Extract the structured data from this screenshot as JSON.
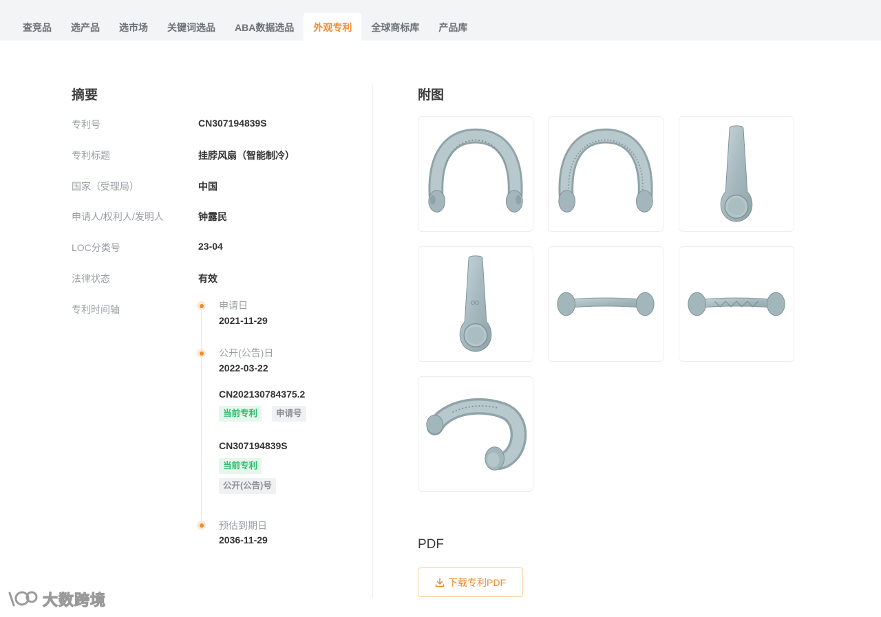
{
  "tabs": [
    {
      "label": "查竞品",
      "active": false
    },
    {
      "label": "选产品",
      "active": false
    },
    {
      "label": "选市场",
      "active": false
    },
    {
      "label": "关键词选品",
      "active": false
    },
    {
      "label": "ABA数据选品",
      "active": false
    },
    {
      "label": "外观专利",
      "active": true
    },
    {
      "label": "全球商标库",
      "active": false
    },
    {
      "label": "产品库",
      "active": false
    }
  ],
  "summary": {
    "title": "摘要",
    "fields": [
      {
        "label": "专利号",
        "value": "CN307194839S"
      },
      {
        "label": "专利标题",
        "value": "挂脖风扇（智能制冷）"
      },
      {
        "label": "国家（受理局）",
        "value": "中国"
      },
      {
        "label": "申请人/权利人/发明人",
        "value": "钟露民"
      },
      {
        "label": "LOC分类号",
        "value": "23-04"
      },
      {
        "label": "法律状态",
        "value": "有效"
      }
    ],
    "timeline_label": "专利时间轴"
  },
  "timeline": {
    "apply_label": "申请日",
    "apply_date": "2021-11-29",
    "publish_label": "公开(公告)日",
    "publish_date": "2022-03-22",
    "entries": [
      {
        "number": "CN202130784375.2",
        "tag1": "当前专利",
        "tag2": "申请号"
      },
      {
        "number": "CN307194839S",
        "tag1": "当前专利",
        "tag2": "公开(公告)号"
      }
    ],
    "expire_label": "预估到期日",
    "expire_date": "2036-11-29"
  },
  "figures": {
    "title": "附图",
    "count": 7
  },
  "pdf": {
    "title": "PDF",
    "button_label": "下载专利PDF"
  },
  "watermark": {
    "text": "大数跨境"
  },
  "colors": {
    "accent": "#ef8a2e",
    "green_tag": "#2fba6b",
    "product": "#a9bcc2"
  }
}
